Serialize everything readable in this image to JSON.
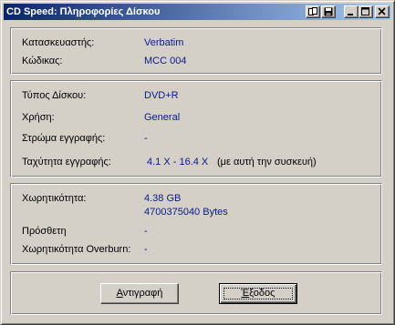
{
  "window": {
    "title": "CD Speed: Πληροφορίες Δίσκου"
  },
  "manufacturer": {
    "manufacturer_label": "Κατασκευαστής:",
    "manufacturer_value": "Verbatim",
    "code_label": "Κώδικας:",
    "code_value": "MCC 004"
  },
  "disc": {
    "type_label": "Τύπος Δίσκου:",
    "type_value": "DVD+R",
    "usage_label": "Χρήση:",
    "usage_value": "General",
    "layer_label": "Στρώμα εγγραφής:",
    "layer_value": "-",
    "speed_label": "Ταχύτητα εγγραφής:",
    "speed_value": "4.1 X - 16.4 X",
    "speed_note": "(με αυτή την συσκευή)"
  },
  "capacity": {
    "capacity_label": "Χωρητικότητα:",
    "capacity_gb": "4.38 GB",
    "capacity_bytes": "4700375040 Bytes",
    "additional_label": "Πρόσθετη",
    "additional_value": "-",
    "overburn_label": "Χωρητικότητα Overburn:",
    "overburn_value": "-"
  },
  "buttons": {
    "copy_label_first": "Α",
    "copy_label_rest": "ντιγραφή",
    "exit_label_first": "Έ",
    "exit_label_rest": "ξοδος"
  }
}
